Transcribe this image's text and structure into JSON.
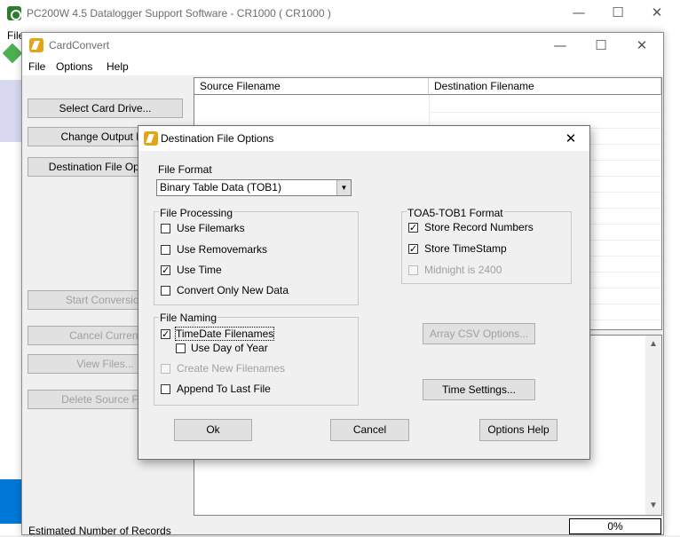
{
  "pc200w": {
    "title": "PC200W 4.5 Datalogger Support Software - CR1000 ( CR1000 )",
    "menu_file": "File",
    "minimize": "—",
    "maximize": "☐",
    "close": "✕"
  },
  "cardconvert": {
    "title": "CardConvert",
    "minimize": "—",
    "maximize": "☐",
    "close": "✕",
    "menu": {
      "file": "File",
      "options": "Options",
      "help": "Help"
    },
    "buttons": {
      "select_card_drive": "Select Card Drive...",
      "change_output_dir": "Change Output Dir",
      "destination_file_options": "Destination File Options",
      "start_conversion": "Start Conversion",
      "cancel_current": "Cancel Current",
      "view_files": "View Files...",
      "delete_source_file": "Delete Source File"
    },
    "list_columns": {
      "source": "Source Filename",
      "destination": "Destination Filename"
    },
    "status_label": "Estimated Number of Records",
    "progress_text": "0%",
    "progress_value": 0
  },
  "dialog": {
    "title": "Destination File Options",
    "close": "✕",
    "file_format_label": "File Format",
    "file_format_value": "Binary Table Data (TOB1)",
    "file_processing": {
      "title": "File Processing",
      "use_filemarks": "Use Filemarks",
      "use_removemarks": "Use Removemarks",
      "use_time": "Use Time",
      "convert_only_new": "Convert Only New Data"
    },
    "file_naming": {
      "title": "File Naming",
      "timedate_filenames": "TimeDate Filenames",
      "use_day_of_year": "Use Day of Year",
      "create_new_filenames": "Create New Filenames",
      "append_to_last_file": "Append To Last File"
    },
    "toa_format": {
      "title": "TOA5-TOB1 Format",
      "store_record_numbers": "Store Record Numbers",
      "store_timestamp": "Store TimeStamp",
      "midnight_2400": "Midnight is 2400"
    },
    "check_mark": "✓",
    "dropdown_arrow": "▼",
    "buttons": {
      "array_csv": "Array CSV Options...",
      "time_settings": "Time Settings...",
      "ok": "Ok",
      "cancel": "Cancel",
      "options_help": "Options Help"
    }
  }
}
